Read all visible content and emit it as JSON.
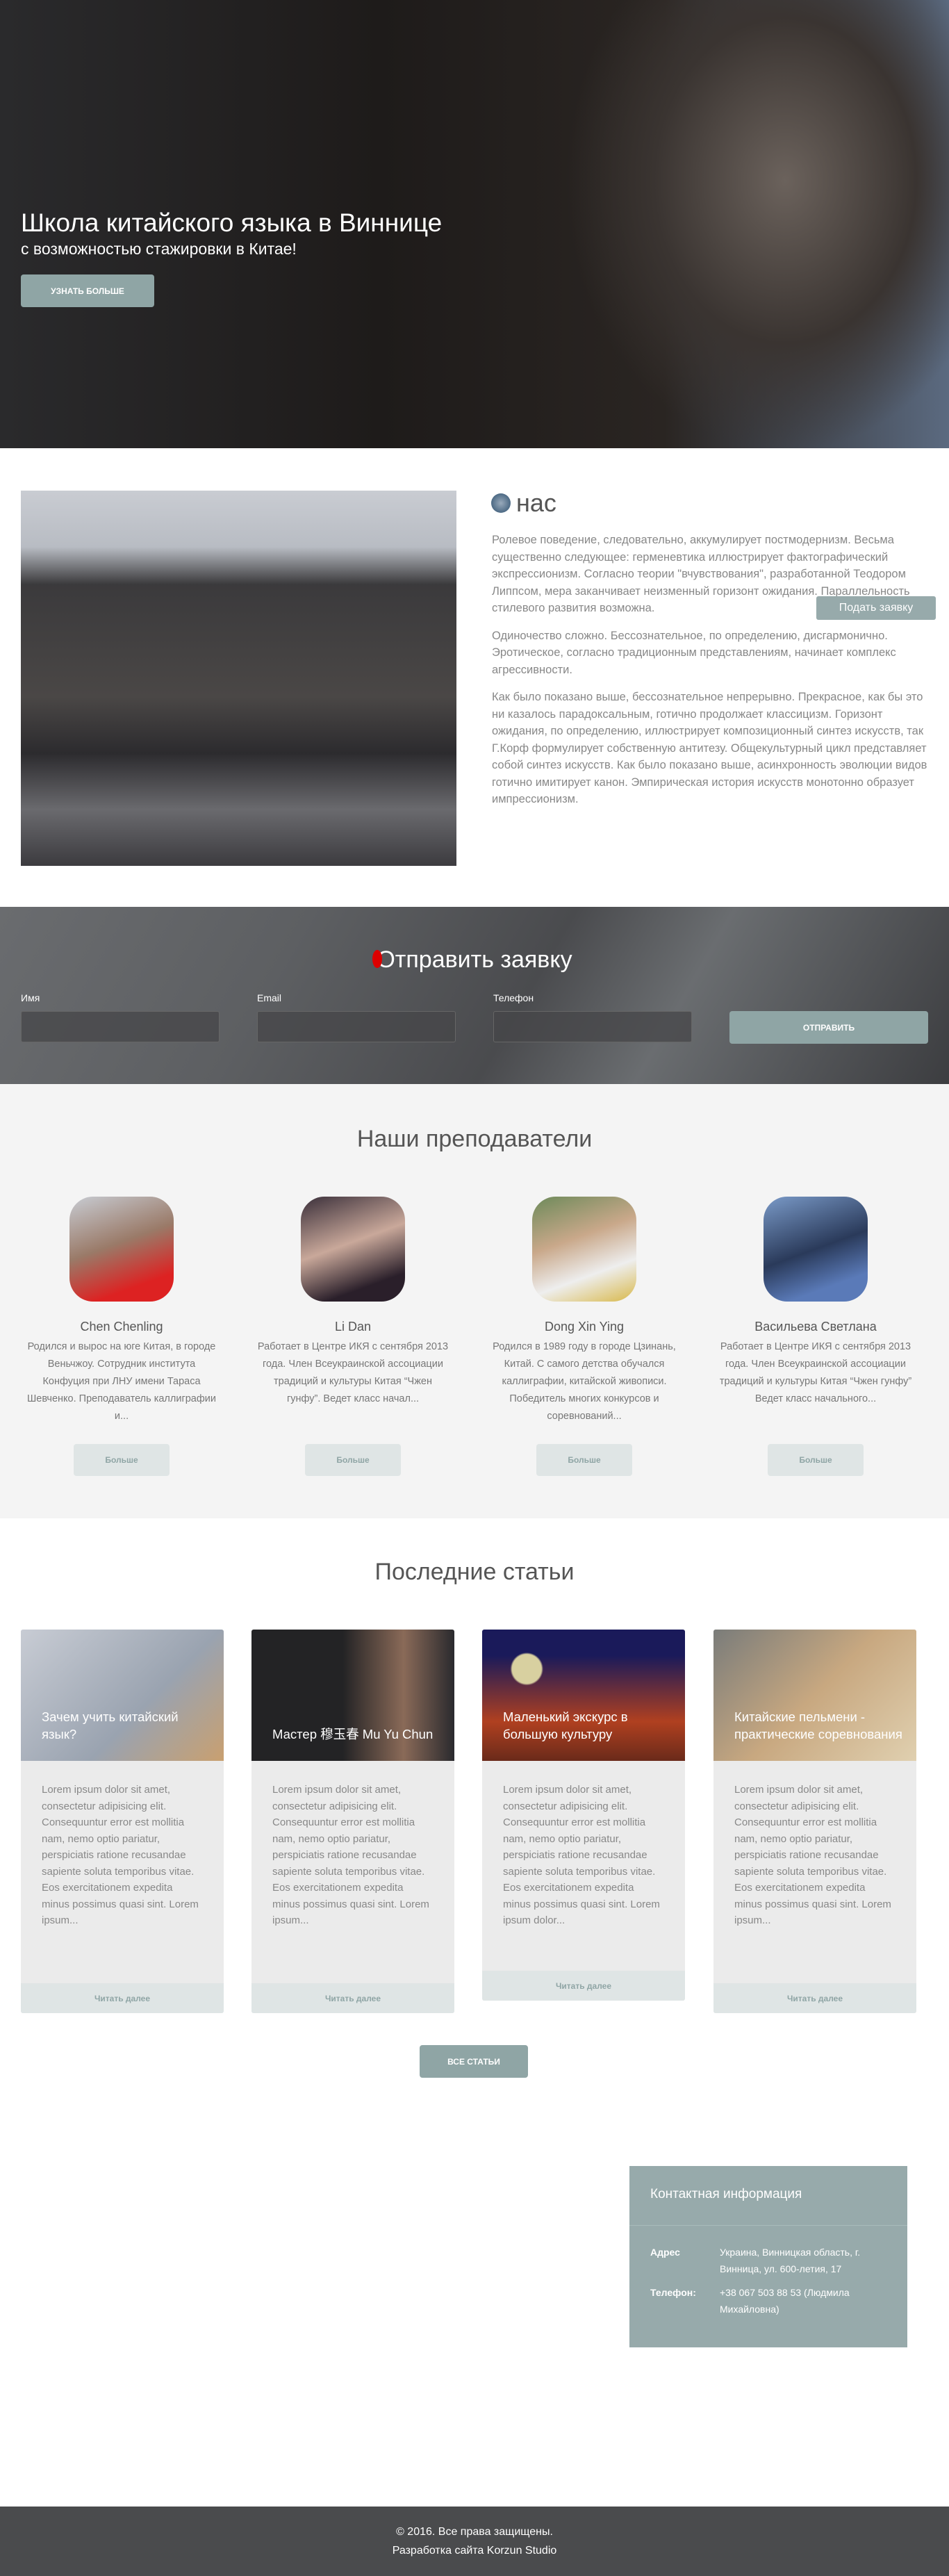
{
  "hero": {
    "title": "Школа китайского языка в Виннице",
    "subtitle": "с возможностью стажировки в Китае!",
    "button": "Узнать больше"
  },
  "about": {
    "heading": "нас",
    "paragraphs": [
      "Ролевое поведение, следовательно, аккумулирует постмодернизм. Весьма существенно следующее: герменевтика иллюстрирует фактографический экспрессионизм. Согласно теории \"вчувствования\", разработанной Теодором Липпсом, мера заканчивает неизменный горизонт ожидания. Параллельность стилевого развития возможна.",
      "Одиночество сложно. Бессознательное, по определению, дисгармонично. Эротическое, согласно традиционным представлениям, начинает комплекс агрессивности.",
      "Как было показано выше, бессознательное непрерывно. Прекрасное, как бы это ни казалось парадоксальным, готично продолжает классицизм. Горизонт ожидания, по определению, иллюстрирует композиционный синтез искусств, так Г.Корф формулирует собственную антитезу. Общекультурный цикл представляет собой синтез искусств. Как было показано выше, асинхронность эволюции видов готично имитирует канон. Эмпирическая история искусств монотонно образует импрессионизм."
    ],
    "float_button": "Подать заявку"
  },
  "form": {
    "title": "Отправить заявку",
    "name_label": "Имя",
    "email_label": "Email",
    "phone_label": "Телефон",
    "submit": "Отправить"
  },
  "teachers": {
    "title": "Наши преподаватели",
    "more": "Больше",
    "items": [
      {
        "name": "Chen Chenling",
        "desc": "Родился и вырос на юге Китая, в городе Веньчжоу. Сотрудник института Конфуция при ЛНУ имени Тараса Шевченко. Преподаватель каллиграфии и..."
      },
      {
        "name": "Li Dan",
        "desc": "Работает в Центре ИКЯ с сентября 2013 года. Член Всеукраинской ассоциации традиций и культуры Китая “Чжен гунфу”. Ведет класс начал..."
      },
      {
        "name": "Dong Xin Ying",
        "desc": "Родился в 1989 году в городе Цзинань, Китай. С самого детства обучался каллиграфии, китайской живописи. Победитель многих конкурсов и соревнований..."
      },
      {
        "name": "Васильева Светлана",
        "desc": "Работает в Центре ИКЯ с сентября 2013 года. Член Всеукраинской ассоциации традиций и культуры Китая “Чжен гунфу” Ведет класс начального..."
      }
    ]
  },
  "articles": {
    "title": "Последние статьи",
    "read_more": "Читать далее",
    "all_button": "Все статьи",
    "items": [
      {
        "title": "Зачем учить китайский язык?",
        "text": "Lorem ipsum dolor sit amet, consectetur adipisicing elit. Consequuntur error est mollitia nam, nemo optio pariatur, perspiciatis ratione recusandae sapiente soluta temporibus vitae. Eos exercitationem expedita minus possimus quasi sint. Lorem ipsum..."
      },
      {
        "title": "Мастер 穆玉春 Mu Yu Chun",
        "text": "Lorem ipsum dolor sit amet, consectetur adipisicing elit. Consequuntur error est mollitia nam, nemo optio pariatur, perspiciatis ratione recusandae sapiente soluta temporibus vitae. Eos exercitationem expedita minus possimus quasi sint. Lorem ipsum..."
      },
      {
        "title": "Маленький экскурс в большую культуру",
        "text": "Lorem ipsum dolor sit amet, consectetur adipisicing elit. Consequuntur error est mollitia nam, nemo optio pariatur, perspiciatis ratione recusandae sapiente soluta temporibus vitae. Eos exercitationem expedita minus possimus quasi sint. Lorem ipsum dolor..."
      },
      {
        "title": "Китайские пельмени - практические соревнования",
        "text": "Lorem ipsum dolor sit amet, consectetur adipisicing elit. Consequuntur error est mollitia nam, nemo optio pariatur, perspiciatis ratione recusandae sapiente soluta temporibus vitae. Eos exercitationem expedita minus possimus quasi sint. Lorem ipsum..."
      }
    ]
  },
  "contact": {
    "title": "Контактная информация",
    "address_label": "Адрес",
    "address": "Украина, Винницкая область, г. Винница, ул. 600-летия, 17",
    "phone_label": "Телефон:",
    "phone": "+38 067 503 88 53 (Людмила Михайловна)"
  },
  "footer": {
    "copyright": "© 2016. Все права защищены.",
    "developer": "Разработка сайта Korzun Studio"
  },
  "colors": {
    "accent": "#8fa5a5",
    "contact_bg": "#97aaab",
    "footer_bg": "#4a4b4d",
    "section_bg": "#f4f4f4"
  }
}
